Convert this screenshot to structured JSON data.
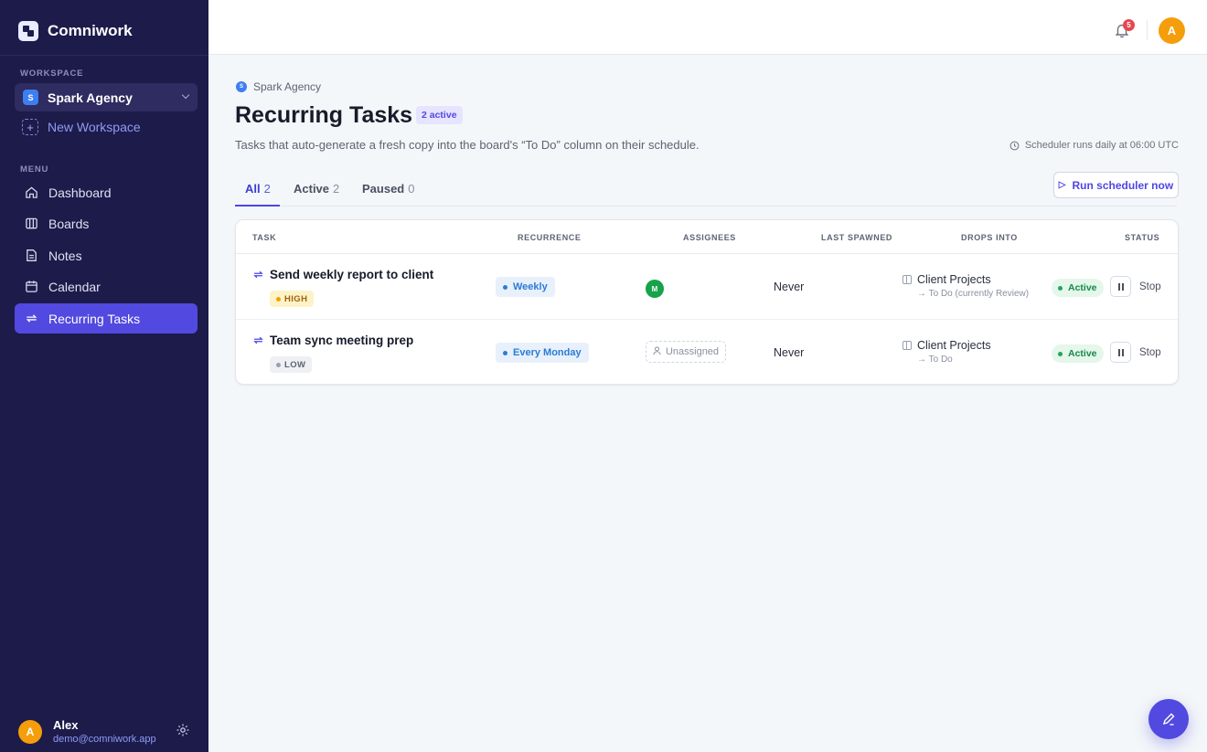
{
  "brand": {
    "name": "Comniwork"
  },
  "sidebar": {
    "workspace_heading": "WORKSPACE",
    "workspace": {
      "badge": "S",
      "name": "Spark Agency"
    },
    "new_workspace": "New Workspace",
    "menu_heading": "MENU",
    "items": [
      {
        "label": "Dashboard",
        "icon": "home-icon"
      },
      {
        "label": "Boards",
        "icon": "board-icon"
      },
      {
        "label": "Notes",
        "icon": "note-icon"
      },
      {
        "label": "Calendar",
        "icon": "calendar-icon"
      },
      {
        "label": "Recurring Tasks",
        "icon": "repeat-icon",
        "active": true
      }
    ],
    "user": {
      "initial": "A",
      "name": "Alex",
      "email": "demo@comniwork.app"
    }
  },
  "topbar": {
    "notification_count": "5",
    "avatar_initial": "A"
  },
  "page": {
    "breadcrumb_badge": "S",
    "breadcrumb": "Spark Agency",
    "title": "Recurring Tasks",
    "active_badge": "2 active",
    "subtitle": "Tasks that auto-generate a fresh copy into the board's “To Do” column on their schedule.",
    "scheduler_note": "Scheduler runs daily at 06:00 UTC",
    "run_button": "Run scheduler now"
  },
  "tabs": [
    {
      "label": "All",
      "count": "2",
      "active": true
    },
    {
      "label": "Active",
      "count": "2"
    },
    {
      "label": "Paused",
      "count": "0"
    }
  ],
  "table": {
    "columns": [
      "TASK",
      "RECURRENCE",
      "ASSIGNEES",
      "LAST SPAWNED",
      "DROPS INTO",
      "STATUS"
    ],
    "rows": [
      {
        "title": "Send weekly report to client",
        "priority": "HIGH",
        "recurrence": "Weekly",
        "assignee": "M",
        "last_spawned": "Never",
        "board": "Client Projects",
        "column": "→ To Do (currently Review)",
        "status": "Active",
        "action": "Stop"
      },
      {
        "title": "Team sync meeting prep",
        "priority": "LOW",
        "recurrence": "Every Monday",
        "assignee": "Unassigned",
        "last_spawned": "Never",
        "board": "Client Projects",
        "column": "→ To Do",
        "status": "Active",
        "action": "Stop"
      }
    ]
  },
  "colors": {
    "sidebar_bg": "#1d1b4a",
    "accent": "#5249e0",
    "active_green": "#17884a",
    "high_priority": "#f59e0b"
  }
}
